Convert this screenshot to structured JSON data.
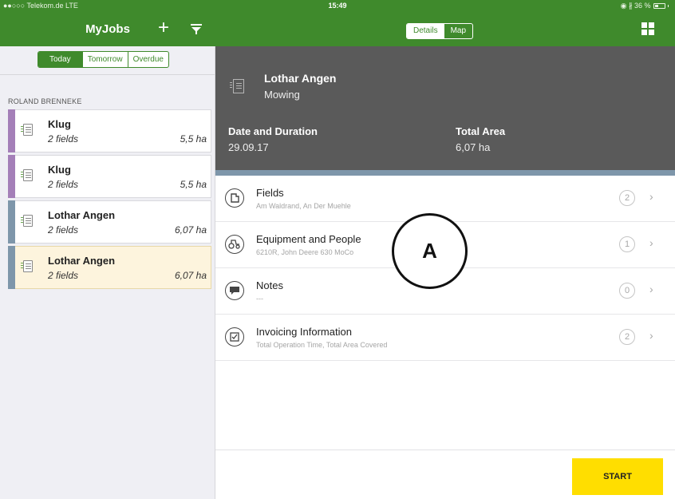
{
  "status_bar": {
    "carrier": "●●○○○ Telekom.de  LTE",
    "time": "15:49",
    "battery": "◉ ∦ 36 %"
  },
  "left_header": {
    "title": "MyJobs",
    "add_icon": "plus-icon",
    "filter_icon": "filter-icon"
  },
  "right_header": {
    "tabs": [
      "Details",
      "Map"
    ],
    "active_tab": "Details",
    "menu_icon": "grid-icon"
  },
  "day_filter": {
    "options": [
      "Today",
      "Tomorrow",
      "Overdue"
    ],
    "active": "Today"
  },
  "job_list": {
    "group": "ROLAND BRENNEKE",
    "jobs": [
      {
        "name": "Klug",
        "fields": "2 fields",
        "area": "5,5 ha",
        "stripe": "#a47fb8",
        "selected": false
      },
      {
        "name": "Klug",
        "fields": "2 fields",
        "area": "5,5 ha",
        "stripe": "#a47fb8",
        "selected": false
      },
      {
        "name": "Lothar Angen",
        "fields": "2 fields",
        "area": "6,07 ha",
        "stripe": "#7e96aa",
        "selected": false
      },
      {
        "name": "Lothar Angen",
        "fields": "2 fields",
        "area": "6,07 ha",
        "stripe": "#7e96aa",
        "selected": true
      }
    ]
  },
  "detail": {
    "name": "Lothar Angen",
    "operation": "Mowing",
    "date_label": "Date and Duration",
    "date_value": "29.09.17",
    "area_label": "Total Area",
    "area_value": "6,07 ha",
    "rows": [
      {
        "title": "Fields",
        "subtitle": "Am Waldrand, An Der Muehle",
        "count": "2",
        "icon": "field-icon"
      },
      {
        "title": "Equipment and People",
        "subtitle": "6210R, John Deere 630 MoCo",
        "count": "1",
        "icon": "tractor-icon"
      },
      {
        "title": "Notes",
        "subtitle": "---",
        "count": "0",
        "icon": "notes-icon"
      },
      {
        "title": "Invoicing Information",
        "subtitle": "Total Operation Time, Total Area Covered",
        "count": "2",
        "icon": "invoice-icon"
      }
    ]
  },
  "annotation": "A",
  "start_label": "START",
  "colors": {
    "brand_green": "#3f8a2c",
    "header_gray": "#5a5a5a",
    "start_yellow": "#ffde00",
    "selected_row": "#fdf4dd"
  }
}
